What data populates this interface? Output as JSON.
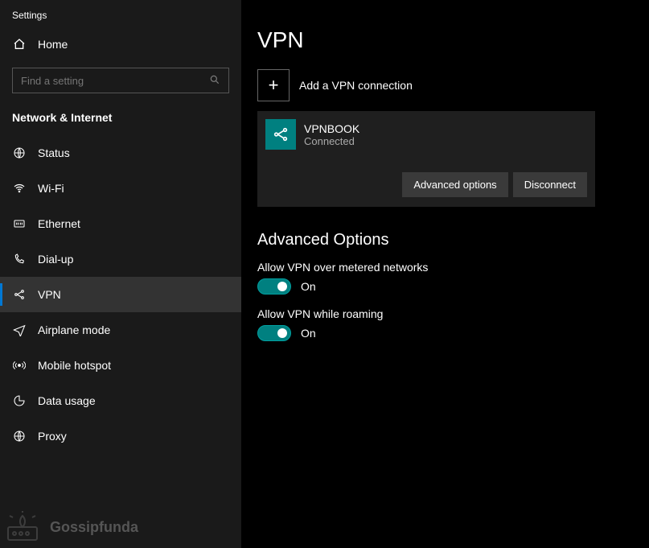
{
  "app_title": "Settings",
  "home_label": "Home",
  "search_placeholder": "Find a setting",
  "section_label": "Network & Internet",
  "colors": {
    "accent_blue": "#0078d4",
    "teal": "#008080",
    "highlight": "#d60000"
  },
  "nav": {
    "items": [
      {
        "id": "status",
        "label": "Status",
        "selected": false
      },
      {
        "id": "wifi",
        "label": "Wi-Fi",
        "selected": false
      },
      {
        "id": "ethernet",
        "label": "Ethernet",
        "selected": false
      },
      {
        "id": "dialup",
        "label": "Dial-up",
        "selected": false
      },
      {
        "id": "vpn",
        "label": "VPN",
        "selected": true
      },
      {
        "id": "airplane",
        "label": "Airplane mode",
        "selected": false
      },
      {
        "id": "hotspot",
        "label": "Mobile hotspot",
        "selected": false
      },
      {
        "id": "data",
        "label": "Data usage",
        "selected": false
      },
      {
        "id": "proxy",
        "label": "Proxy",
        "selected": false
      }
    ]
  },
  "page": {
    "title": "VPN",
    "add_label": "Add a VPN connection",
    "connection": {
      "name": "VPNBOOK",
      "status": "Connected",
      "advanced_btn": "Advanced options",
      "disconnect_btn": "Disconnect"
    },
    "adv_section": "Advanced Options",
    "opt1_label": "Allow VPN over metered networks",
    "opt1_state": "On",
    "opt2_label": "Allow VPN while roaming",
    "opt2_state": "On"
  },
  "watermark": "Gossipfunda"
}
